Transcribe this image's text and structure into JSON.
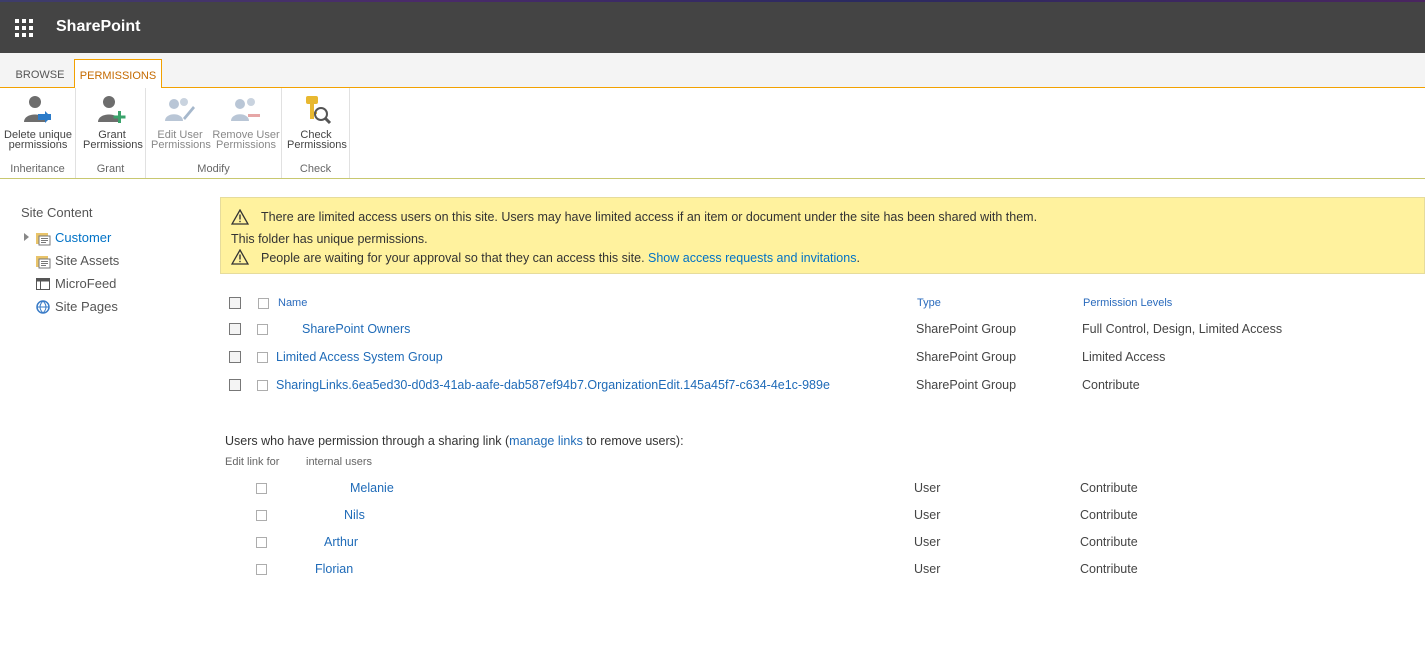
{
  "app": {
    "title": "SharePoint"
  },
  "ribbon": {
    "tabs": [
      {
        "label": "BROWSE",
        "selected": false
      },
      {
        "label": "PERMISSIONS",
        "selected": true
      }
    ],
    "groups": [
      {
        "label": "Inheritance",
        "buttons": [
          {
            "line1": "Delete unique",
            "line2": "permissions",
            "icon": "delete-unique-permissions-icon",
            "enabled": true
          }
        ]
      },
      {
        "label": "Grant",
        "buttons": [
          {
            "line1": "Grant",
            "line2": "Permissions",
            "icon": "grant-permissions-icon",
            "enabled": true
          }
        ]
      },
      {
        "label": "Modify",
        "buttons": [
          {
            "line1": "Edit User",
            "line2": "Permissions",
            "icon": "edit-user-permissions-icon",
            "enabled": false
          },
          {
            "line1": "Remove User",
            "line2": "Permissions",
            "icon": "remove-user-permissions-icon",
            "enabled": false
          }
        ]
      },
      {
        "label": "Check",
        "buttons": [
          {
            "line1": "Check",
            "line2": "Permissions",
            "icon": "check-permissions-icon",
            "enabled": true
          }
        ]
      }
    ]
  },
  "leftnav": {
    "title": "Site Content",
    "items": [
      {
        "label": "Customer",
        "icon": "document-library-icon",
        "active": true
      },
      {
        "label": "Site Assets",
        "icon": "document-library-icon",
        "active": false
      },
      {
        "label": "MicroFeed",
        "icon": "list-icon",
        "active": false
      },
      {
        "label": "Site Pages",
        "icon": "site-pages-icon",
        "active": false
      }
    ]
  },
  "banner": {
    "line1": "There are limited access users on this site. Users may have limited access if an item or document under the site has been shared with them.",
    "line2": "This folder has unique permissions.",
    "line3_text": "People are waiting for your approval so that they can access this site. ",
    "line3_link": "Show access requests and invitations",
    "line3_end": "."
  },
  "table": {
    "headers": {
      "name": "Name",
      "type": "Type",
      "levels": "Permission Levels"
    },
    "rows": [
      {
        "name": "SharePoint Owners",
        "type": "SharePoint Group",
        "levels": "Full Control, Design, Limited Access"
      },
      {
        "name": "Limited Access System Group",
        "type": "SharePoint Group",
        "levels": "Limited Access"
      },
      {
        "name": "SharingLinks.6ea5ed30-d0d3-41ab-aafe-dab587ef94b7.OrganizationEdit.145a45f7-c634-4e1c-989e",
        "type": "SharePoint Group",
        "levels": "Contribute"
      }
    ]
  },
  "sharing": {
    "prefix": "Users who have permission through a sharing link (",
    "link": "manage links",
    "suffix": " to remove users):",
    "edit_link_for": "Edit link for",
    "internal_users": "internal users",
    "users": [
      {
        "name": "Melanie",
        "type": "User",
        "levels": "Contribute"
      },
      {
        "name": "Nils",
        "type": "User",
        "levels": "Contribute"
      },
      {
        "name": "Arthur",
        "type": "User",
        "levels": "Contribute"
      },
      {
        "name": "Florian",
        "type": "User",
        "levels": "Contribute"
      }
    ]
  },
  "colors": {
    "suitebar": "#444444",
    "accent": "#f2a100",
    "link": "#1f6bb8",
    "banner": "#fff29e"
  }
}
